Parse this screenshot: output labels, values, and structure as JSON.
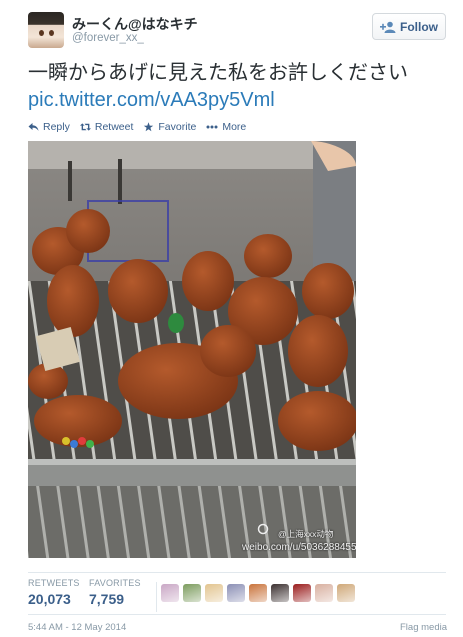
{
  "user": {
    "display_name": "みーくん@はなキチ",
    "handle": "@forever_xx_",
    "avatar_icon": "user-avatar"
  },
  "follow_button": {
    "label": "Follow",
    "icon": "add-user-icon"
  },
  "tweet": {
    "text": "一瞬からあげに見えた私をお許しください",
    "link": "pic.twitter.com/vAA3py5Vml"
  },
  "actions": {
    "reply": "Reply",
    "retweet": "Retweet",
    "favorite": "Favorite",
    "more": "More"
  },
  "media": {
    "watermark_line1": "@上海xxx动物",
    "watermark_line2": "weibo.com/u/5036288455"
  },
  "stats": {
    "retweets_label": "RETWEETS",
    "retweets_value": "20,073",
    "favorites_label": "FAVORITES",
    "favorites_value": "7,759"
  },
  "favoriters": [
    {
      "name": "favoriter-avatar-1",
      "color": "#c9a7c5"
    },
    {
      "name": "favoriter-avatar-2",
      "color": "#7c9c5e"
    },
    {
      "name": "favoriter-avatar-3",
      "color": "#e2c48f"
    },
    {
      "name": "favoriter-avatar-4",
      "color": "#8b8fb5"
    },
    {
      "name": "favoriter-avatar-5",
      "color": "#c9733b"
    },
    {
      "name": "favoriter-avatar-6",
      "color": "#3b3030"
    },
    {
      "name": "favoriter-avatar-7",
      "color": "#9a1c1c"
    },
    {
      "name": "favoriter-avatar-8",
      "color": "#d8b0a0"
    },
    {
      "name": "favoriter-avatar-9",
      "color": "#cfa878"
    }
  ],
  "footer": {
    "timestamp": "5:44 AM - 12 May 2014",
    "flag_media": "Flag media"
  },
  "colors": {
    "link": "#2b7bb9",
    "action": "#3b5f8a",
    "muted": "#8899a6",
    "puppy": "#8e3f1e"
  }
}
